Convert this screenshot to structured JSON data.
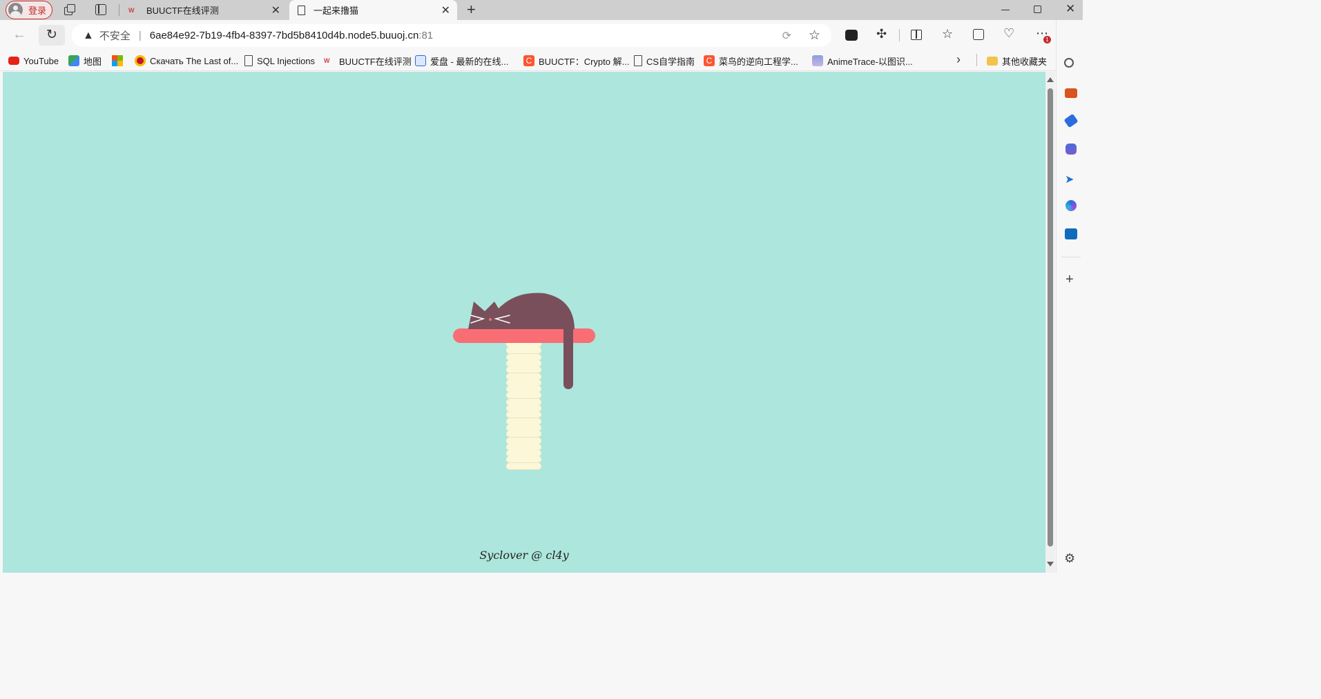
{
  "browser": {
    "login_label": "登录",
    "tabs": [
      {
        "title": "BUUCTF在线评测",
        "active": false
      },
      {
        "title": "一起来撸猫",
        "active": true
      }
    ],
    "new_tab": "+",
    "security_label": "不安全",
    "url_host": "6ae84e92-7b19-4fb4-8397-7bd5b8410d4b.node5.buuoj.cn",
    "url_port": ":81",
    "badge_count": "1"
  },
  "bookmarks": [
    {
      "label": "YouTube",
      "icon": "youtube-icon"
    },
    {
      "label": "地图",
      "icon": "maps-icon"
    },
    {
      "label": "",
      "icon": "microsoft-icon"
    },
    {
      "label": "Скачать The Last of...",
      "icon": "emblem-icon"
    },
    {
      "label": "SQL Injections",
      "icon": "page-icon"
    },
    {
      "label": "BUUCTF在线评测",
      "icon": "buuctf-icon"
    },
    {
      "label": "爱盘 - 最新的在线...",
      "icon": "aipan-icon"
    },
    {
      "label": "BUUCTF：Crypto 解...",
      "icon": "csdn-icon"
    },
    {
      "label": "CS自学指南",
      "icon": "page-icon"
    },
    {
      "label": "菜鸟的逆向工程学...",
      "icon": "csdn-icon"
    },
    {
      "label": "AnimeTrace-以图识...",
      "icon": "anime-icon"
    }
  ],
  "other_favorites": "其他收藏夹",
  "page": {
    "footer": "Syclover @ cl4y"
  },
  "colors": {
    "page_bg": "#ade6dc",
    "cat": "#7a4f5c",
    "shelf": "#f86e74",
    "post": "#fbf7d8",
    "nose": "#f86e74"
  }
}
